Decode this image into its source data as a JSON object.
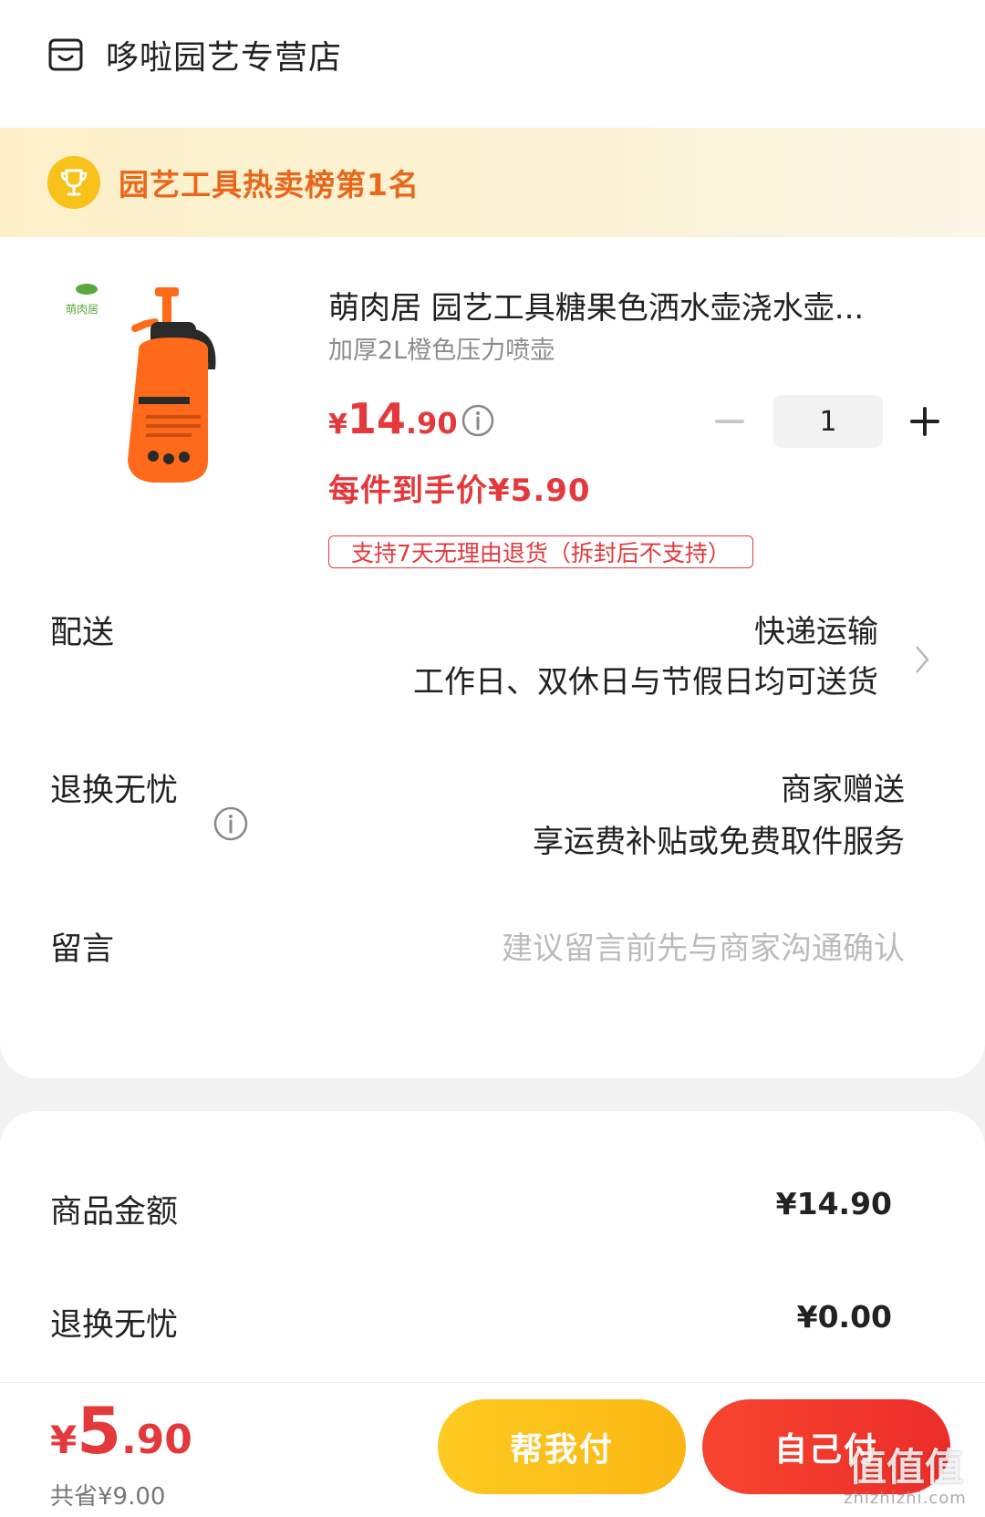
{
  "store": {
    "name": "哆啦园艺专营店",
    "icon": "store-icon"
  },
  "rank_banner": {
    "text": "园艺工具热卖榜第1名",
    "icon": "trophy-icon"
  },
  "product": {
    "title": "萌肉居 园艺工具糖果色洒水壶浇水壶...",
    "spec": "加厚2L橙色压力喷壶",
    "price_symbol": "¥",
    "price_int": "14",
    "price_dec": ".90",
    "final_price": "每件到手价¥5.90",
    "return_tag": "支持7天无理由退货（拆封后不支持）",
    "quantity": "1",
    "image_icon": "spray-bottle-image"
  },
  "delivery": {
    "label": "配送",
    "method": "快递运输",
    "note": "工作日、双休日与节假日均可送货"
  },
  "return_service": {
    "label": "退换无忧",
    "value": "商家赠送",
    "note": "享运费补贴或免费取件服务"
  },
  "message": {
    "label": "留言",
    "placeholder": "建议留言前先与商家沟通确认"
  },
  "summary": {
    "items": [
      {
        "label": "商品金额",
        "value": "¥14.90"
      },
      {
        "label": "退换无忧",
        "value": "¥0.00"
      }
    ]
  },
  "bottom": {
    "total_symbol": "¥",
    "total_int": "5",
    "total_dec": ".90",
    "saved": "共省¥9.00",
    "help_pay": "帮我付",
    "self_pay": "自己付",
    "watermark": "值值值",
    "watermark_sub": "zhizhizhi.com"
  },
  "colors": {
    "accent_red": "#e4393c",
    "yellow": "#fbb714",
    "rank_orange": "#e8671b"
  }
}
